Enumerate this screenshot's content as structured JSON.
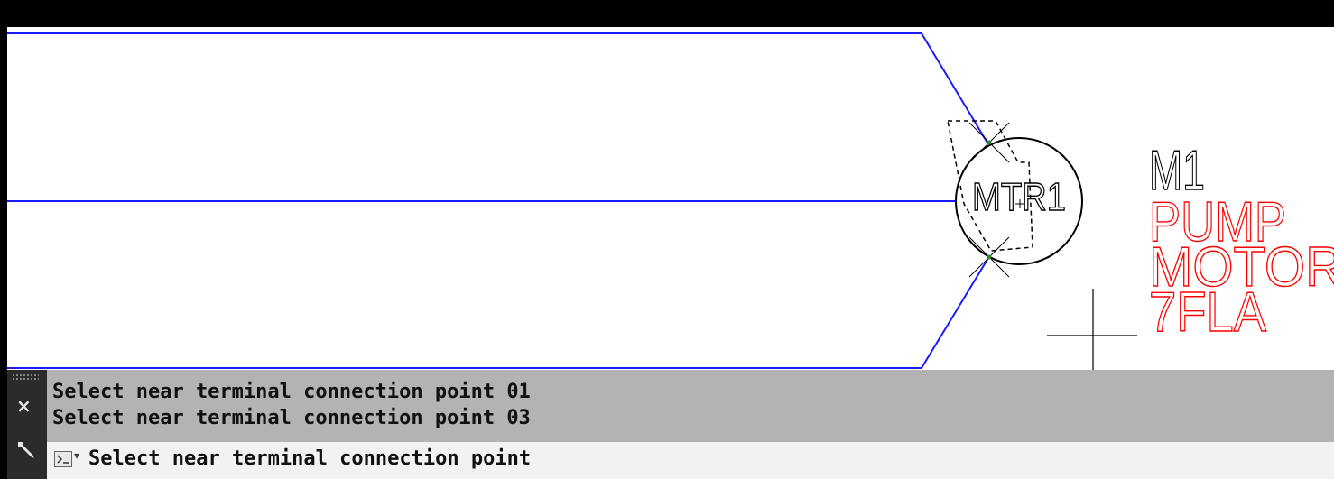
{
  "drawing": {
    "component_tag": "MTR1",
    "label_lines": [
      "M1",
      "PUMP",
      "MOTOR",
      "7FLA"
    ],
    "wire_color": "#1a1aff",
    "label_tag_color": "#000000",
    "label_desc_color": "#ff0000"
  },
  "command_line": {
    "history": [
      "Select near terminal connection point 01",
      "Select near terminal connection point 03"
    ],
    "prompt": "Select near terminal connection point",
    "close_icon": "×",
    "icons": [
      "grip-icon",
      "close-icon",
      "wrench-icon",
      "command-prompt-icon",
      "chevron-down-icon"
    ]
  }
}
